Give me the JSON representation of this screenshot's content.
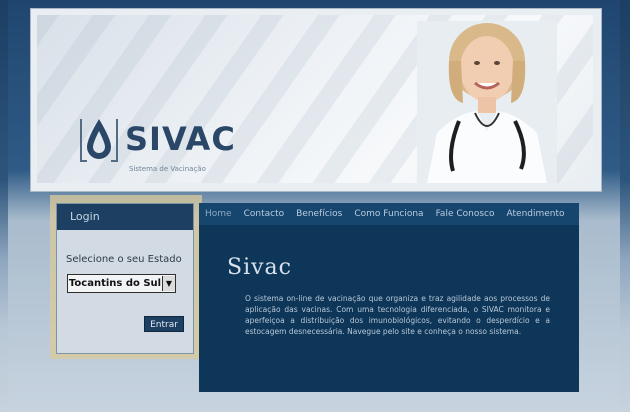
{
  "banner": {
    "logo_text": "SIVAC",
    "logo_subtitle": "Sistema de Vacinação",
    "logo_icon": "drop-icon"
  },
  "login": {
    "title": "Login",
    "state_label": "Selecione o seu Estado",
    "state_selected": "Tocantins do Sul",
    "enter_label": "Entrar"
  },
  "nav": {
    "items": [
      "Home",
      "Contacto",
      "Benefícios",
      "Como Funciona",
      "Fale Conosco",
      "Atendimento"
    ]
  },
  "main": {
    "title": "Sivac",
    "text": "O sistema on-line de vacinação que organiza e traz agilidade aos processos de aplicação das vacinas. Com uma tecnologia diferenciada, o SIVAC monitora e aperfeiçoa a distribuição dos imunobiológicos, evitando o desperdício e a estocagem desnecessária. Navegue pelo site e conheça o nosso sistema."
  },
  "colors": {
    "primary": "#1d3f61",
    "content_bg": "#0e3658",
    "login_border_accent": "#d9c99a"
  }
}
